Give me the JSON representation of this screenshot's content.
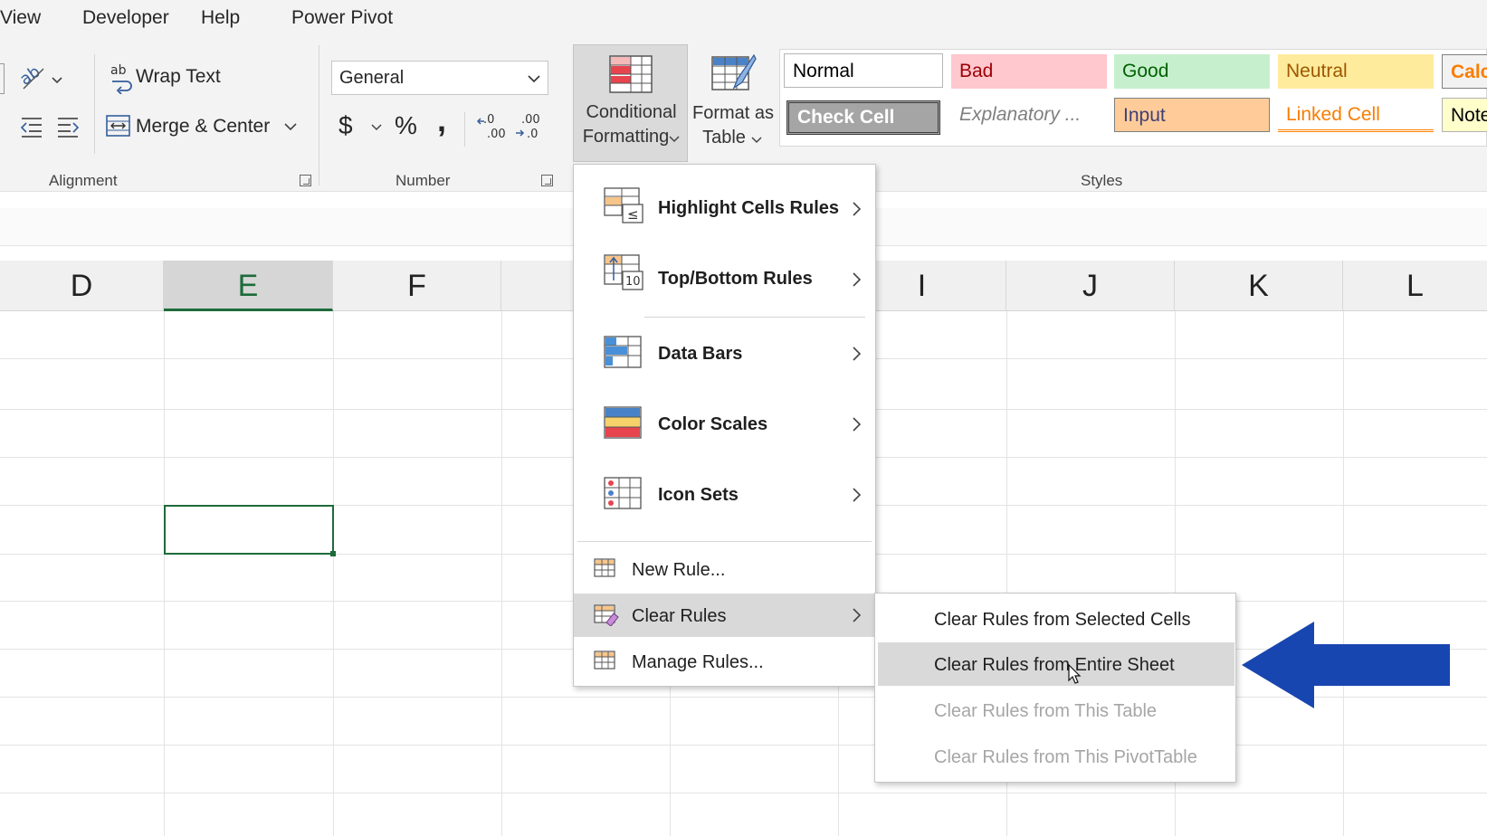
{
  "menubar": {
    "items": [
      "View",
      "Developer",
      "Help",
      "Power Pivot"
    ]
  },
  "ribbon": {
    "alignment": {
      "wrap_text": "Wrap Text",
      "merge_center": "Merge & Center",
      "group_label": "Alignment"
    },
    "number": {
      "format_value": "General",
      "currency": "$",
      "percent": "%",
      "comma": ",",
      "group_label": "Number"
    },
    "conditional_formatting": {
      "line1": "Conditional",
      "line2": "Formatting"
    },
    "format_as_table": {
      "line1": "Format as",
      "line2": "Table"
    },
    "styles": {
      "group_label": "Styles",
      "cells": [
        {
          "label": "Normal",
          "bg": "#ffffff",
          "fg": "#000000"
        },
        {
          "label": "Bad",
          "bg": "#ffc7ce",
          "fg": "#9c0006"
        },
        {
          "label": "Good",
          "bg": "#c6efce",
          "fg": "#006100"
        },
        {
          "label": "Neutral",
          "bg": "#ffeb9c",
          "fg": "#9c5700"
        },
        {
          "label": "Calc",
          "bg": "#f2f2f2",
          "fg": "#fa7d00"
        },
        {
          "label": "Check Cell",
          "bg": "#a5a5a5",
          "fg": "#ffffff"
        },
        {
          "label": "Explanatory ...",
          "bg": "#ffffff",
          "fg": "#7f7f7f"
        },
        {
          "label": "Input",
          "bg": "#ffcc99",
          "fg": "#3f3f76"
        },
        {
          "label": "Linked Cell",
          "bg": "#ffffff",
          "fg": "#fa7d00"
        },
        {
          "label": "Note",
          "bg": "#ffffcc",
          "fg": "#000000"
        }
      ]
    }
  },
  "grid": {
    "columns": [
      "D",
      "E",
      "F",
      "I",
      "J",
      "K",
      "L"
    ],
    "selected_column": "E"
  },
  "cf_menu": {
    "items": [
      {
        "label": "Highlight Cells Rules",
        "icon": "highlight-cells-icon"
      },
      {
        "label": "Top/Bottom Rules",
        "icon": "top-bottom-icon"
      },
      {
        "label": "Data Bars",
        "icon": "data-bars-icon"
      },
      {
        "label": "Color Scales",
        "icon": "color-scales-icon"
      },
      {
        "label": "Icon Sets",
        "icon": "icon-sets-icon"
      }
    ],
    "new_rule": "New Rule...",
    "clear_rules": "Clear Rules",
    "manage_rules": "Manage Rules..."
  },
  "clear_submenu": {
    "items": [
      {
        "label": "Clear Rules from Selected Cells",
        "enabled": true
      },
      {
        "label": "Clear Rules from Entire Sheet",
        "enabled": true
      },
      {
        "label": "Clear Rules from This Table",
        "enabled": false
      },
      {
        "label": "Clear Rules from This PivotTable",
        "enabled": false
      }
    ]
  },
  "colors": {
    "accent_green": "#1e6b3a",
    "arrow_blue": "#1846b0"
  }
}
